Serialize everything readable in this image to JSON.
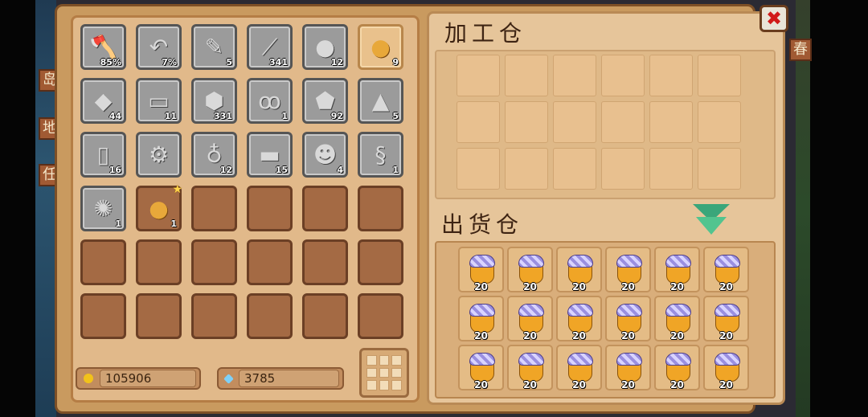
{
  "side_tabs_left": [
    "岛",
    "地",
    "任"
  ],
  "side_tabs_right": [
    "春"
  ],
  "close_label": "✖",
  "inventory": {
    "slots": [
      {
        "icon": "axe-icon",
        "glyph": "🪓",
        "qty": "85%",
        "highlight": false
      },
      {
        "icon": "sickle-icon",
        "glyph": "↶",
        "qty": "7%",
        "highlight": false
      },
      {
        "icon": "feather-icon",
        "glyph": "✎",
        "qty": "5",
        "highlight": false
      },
      {
        "icon": "branch-icon",
        "glyph": "⟋",
        "qty": "341",
        "highlight": false
      },
      {
        "icon": "stone-icon",
        "glyph": "●",
        "qty": "12",
        "highlight": false
      },
      {
        "icon": "potato-icon",
        "glyph": "●",
        "qty": "9",
        "highlight": true,
        "gold": true
      },
      {
        "icon": "rock-icon",
        "glyph": "◆",
        "qty": "44",
        "highlight": false
      },
      {
        "icon": "iron-bar-icon",
        "glyph": "▭",
        "qty": "11",
        "highlight": false
      },
      {
        "icon": "coal-icon",
        "glyph": "⬢",
        "qty": "331",
        "highlight": false
      },
      {
        "icon": "cherry-icon",
        "glyph": "ꝏ",
        "qty": "1",
        "highlight": false
      },
      {
        "icon": "crystal-ore-icon",
        "glyph": "⬟",
        "qty": "92",
        "highlight": false
      },
      {
        "icon": "pyramid-stone-icon",
        "glyph": "▲",
        "qty": "5",
        "highlight": false
      },
      {
        "icon": "milk-bottle-icon",
        "glyph": "▯",
        "qty": "16",
        "highlight": false
      },
      {
        "icon": "gear-key-icon",
        "glyph": "⚙",
        "qty": "",
        "highlight": false
      },
      {
        "icon": "gourd-icon",
        "glyph": "♁",
        "qty": "12",
        "highlight": false
      },
      {
        "icon": "lumber-icon",
        "glyph": "▬",
        "qty": "15",
        "highlight": false
      },
      {
        "icon": "creature-icon",
        "glyph": "☻",
        "qty": "4",
        "highlight": false
      },
      {
        "icon": "rope-icon",
        "glyph": "§",
        "qty": "1",
        "highlight": false
      },
      {
        "icon": "beetle-icon",
        "glyph": "✺",
        "qty": "1",
        "highlight": false
      },
      {
        "icon": "golden-potato-icon",
        "glyph": "●",
        "qty": "1",
        "highlight": false,
        "gold": true,
        "star": true,
        "empty_bg": true
      }
    ],
    "empty_count": 16
  },
  "currency": {
    "gold": "105906",
    "gem": "3785",
    "gold_color": "#f2c21a",
    "gem_color": "#7fd0f7"
  },
  "processing": {
    "title": "加工仓",
    "slots": 18
  },
  "shipping": {
    "title": "出货仓",
    "item_icon": "honey-jar-icon",
    "slots": [
      "20",
      "20",
      "20",
      "20",
      "20",
      "20",
      "20",
      "20",
      "20",
      "20",
      "20",
      "20",
      "20",
      "20",
      "20",
      "20",
      "20",
      "20"
    ]
  }
}
